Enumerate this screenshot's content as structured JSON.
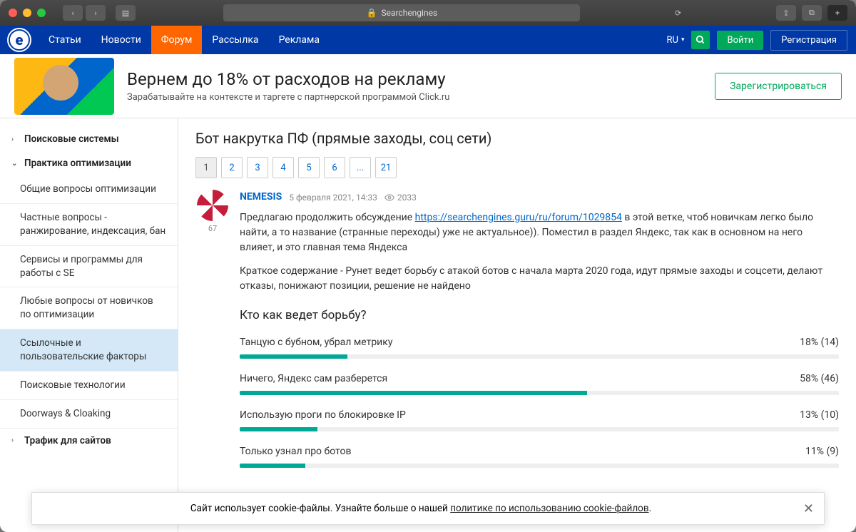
{
  "browser": {
    "title": "Searchengines"
  },
  "nav": {
    "items": [
      "Статьи",
      "Новости",
      "Форум",
      "Рассылка",
      "Реклама"
    ],
    "active_index": 2,
    "lang": "RU",
    "login": "Войти",
    "register": "Регистрация"
  },
  "banner": {
    "title": "Вернем до 18% от расходов на рекламу",
    "subtitle": "Зарабатывайте на контексте и таргете с партнерской программой Click.ru",
    "cta": "Зарегистрироваться"
  },
  "sidebar": {
    "groups": [
      {
        "label": "Поисковые системы",
        "expanded": false
      },
      {
        "label": "Практика оптимизации",
        "expanded": true,
        "children": [
          "Общие вопросы оптимизации",
          "Частные вопросы - ранжирование, индексация, бан",
          "Сервисы и программы для работы с SE",
          "Любые вопросы от новичков по оптимизации",
          "Ссылочные и пользовательские факторы",
          "Поисковые технологии",
          "Doorways & Cloaking"
        ],
        "active_child": 4
      },
      {
        "label": "Трафик для сайтов",
        "expanded": false
      }
    ]
  },
  "thread": {
    "title": "Бот накрутка ПФ (прямые заходы, соц сети)",
    "pages": [
      "1",
      "2",
      "3",
      "4",
      "5",
      "6",
      "...",
      "21"
    ],
    "current_page": 0
  },
  "post": {
    "author": "NEMESIS",
    "date": "5 февраля 2021, 14:33",
    "views": "2033",
    "avatar_num": "67",
    "p1_a": "Предлагаю продолжить обсуждение ",
    "p1_link": "https://searchengines.guru/ru/forum/1029854",
    "p1_b": " в этой ветке, чтоб новичкам легко было найти, а то название (странные переходы) уже не актуальное)). Поместил в раздел Яндекс, так как в основном на него влияет, и это главная тема Яндекса",
    "p2": "Краткое содержание - Рунет ведет борьбу с атакой ботов с начала марта 2020 года, идут прямые заходы и соцсети, делают отказы, понижают позиции, решение не найдено"
  },
  "poll": {
    "question": "Кто как ведет борьбу?",
    "options": [
      {
        "label": "Танцую с бубном, убрал метрику",
        "pct": 18,
        "count": 14
      },
      {
        "label": "Ничего, Яндекс сам разберется",
        "pct": 58,
        "count": 46
      },
      {
        "label": "Использую проги по блокировке IP",
        "pct": 13,
        "count": 10
      },
      {
        "label": "Только узнал про ботов",
        "pct": 11,
        "count": 9
      }
    ]
  },
  "cookie": {
    "text_a": "Сайт использует cookie-файлы. Узнайте больше о нашей ",
    "link": "политике по использованию cookie-файлов",
    "text_b": "."
  },
  "chart_data": {
    "type": "bar",
    "title": "Кто как ведет борьбу?",
    "categories": [
      "Танцую с бубном, убрал метрику",
      "Ничего, Яндекс сам разберется",
      "Использую проги по блокировке IP",
      "Только узнал про ботов"
    ],
    "values": [
      18,
      58,
      13,
      11
    ],
    "counts": [
      14,
      46,
      10,
      9
    ],
    "xlabel": "",
    "ylabel": "%",
    "ylim": [
      0,
      100
    ]
  }
}
